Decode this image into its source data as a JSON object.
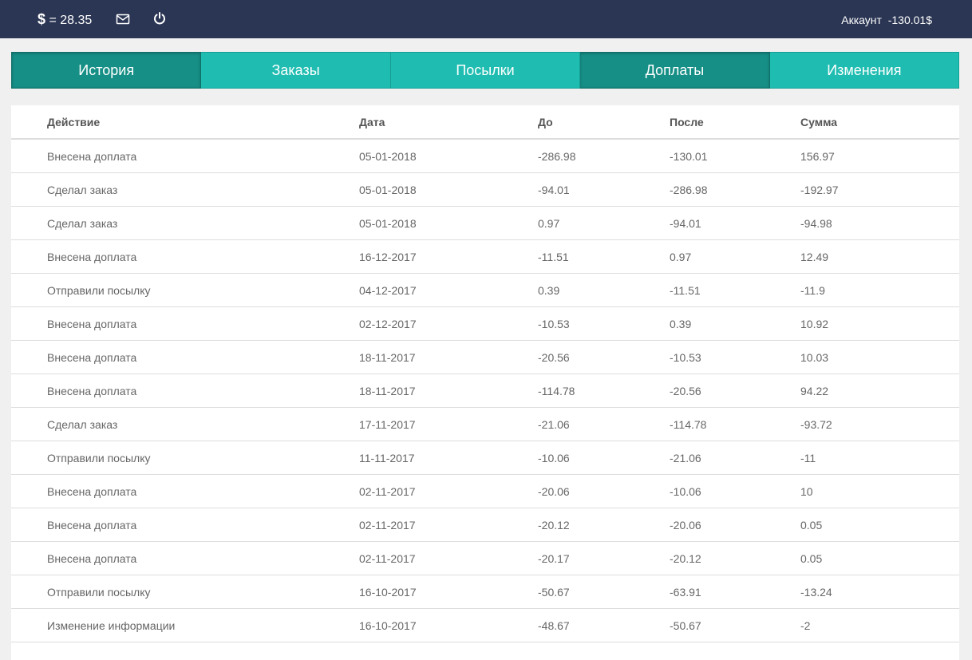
{
  "header": {
    "currency_symbol": "$",
    "rate_text": "= 28.35",
    "mail_icon": "envelope-icon",
    "power_icon": "power-icon",
    "account_label": "Аккаунт",
    "account_balance": "-130.01$"
  },
  "tabs": [
    {
      "label": "История",
      "active": true
    },
    {
      "label": "Заказы",
      "active": false
    },
    {
      "label": "Посылки",
      "active": false
    },
    {
      "label": "Доплаты",
      "active": true
    },
    {
      "label": "Изменения",
      "active": false
    }
  ],
  "table": {
    "columns": [
      "Действие",
      "Дата",
      "До",
      "После",
      "Сумма"
    ],
    "rows": [
      [
        "Внесена доплата",
        "05-01-2018",
        "-286.98",
        "-130.01",
        "156.97"
      ],
      [
        "Сделал заказ",
        "05-01-2018",
        "-94.01",
        "-286.98",
        "-192.97"
      ],
      [
        "Сделал заказ",
        "05-01-2018",
        "0.97",
        "-94.01",
        "-94.98"
      ],
      [
        "Внесена доплата",
        "16-12-2017",
        "-11.51",
        "0.97",
        "12.49"
      ],
      [
        "Отправили посылку",
        "04-12-2017",
        "0.39",
        "-11.51",
        "-11.9"
      ],
      [
        "Внесена доплата",
        "02-12-2017",
        "-10.53",
        "0.39",
        "10.92"
      ],
      [
        "Внесена доплата",
        "18-11-2017",
        "-20.56",
        "-10.53",
        "10.03"
      ],
      [
        "Внесена доплата",
        "18-11-2017",
        "-114.78",
        "-20.56",
        "94.22"
      ],
      [
        "Сделал заказ",
        "17-11-2017",
        "-21.06",
        "-114.78",
        "-93.72"
      ],
      [
        "Отправили посылку",
        "11-11-2017",
        "-10.06",
        "-21.06",
        "-11"
      ],
      [
        "Внесена доплата",
        "02-11-2017",
        "-20.06",
        "-10.06",
        "10"
      ],
      [
        "Внесена доплата",
        "02-11-2017",
        "-20.12",
        "-20.06",
        "0.05"
      ],
      [
        "Внесена доплата",
        "02-11-2017",
        "-20.17",
        "-20.12",
        "0.05"
      ],
      [
        "Отправили посылку",
        "16-10-2017",
        "-50.67",
        "-63.91",
        "-13.24"
      ],
      [
        "Изменение информации",
        "16-10-2017",
        "-48.67",
        "-50.67",
        "-2"
      ]
    ]
  },
  "colors": {
    "topbar": "#2b3654",
    "tab": "#1fbdb1",
    "tab_active": "#168f86"
  }
}
